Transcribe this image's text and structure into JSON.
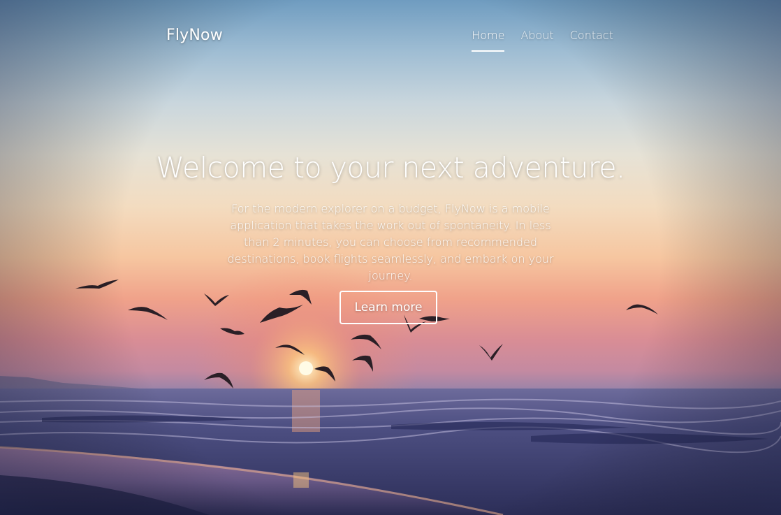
{
  "brand": {
    "name": "FlyNow"
  },
  "nav": {
    "items": [
      {
        "label": "Home",
        "active": true
      },
      {
        "label": "About",
        "active": false
      },
      {
        "label": "Contact",
        "active": false
      }
    ]
  },
  "hero": {
    "headline": "Welcome to your next adventure.",
    "lead": "For the modern explorer on a budget, FlyNow is a mobile application that takes the work out of spontaneity. In less than 2 minutes, you can choose from recommended destinations, book flights seamlessly, and embark on your journey.",
    "cta_label": "Learn more"
  },
  "colors": {
    "sky_top": "#6f9cc0",
    "sunset": "#f6c6a0",
    "sea": "#3a3f6e",
    "text": "#ffffff"
  }
}
